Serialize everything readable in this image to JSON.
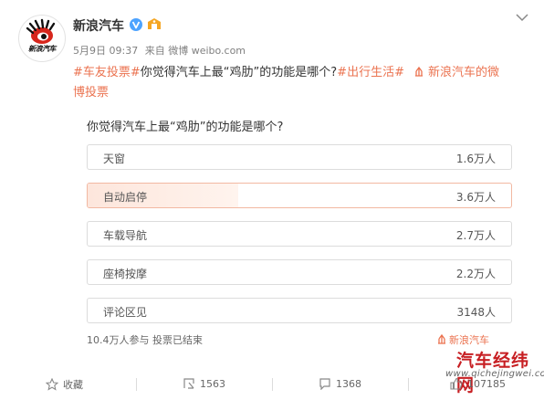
{
  "account": {
    "name": "新浪汽车",
    "avatar_text": "新浪汽车",
    "avatar_icon": "sina-eye-logo",
    "verified_icon": "verified-v-icon",
    "vip_icon": "vip-member-icon",
    "menu_icon": "chevron-down-icon"
  },
  "meta": {
    "date": "5月9日 09:37",
    "from": "来自 微博 weibo.com"
  },
  "post": {
    "tag1": "#车友投票#",
    "text": "你觉得汽车上最“鸡肋”的功能是哪个?",
    "tag2": "#出行生活#",
    "link_icon": "link-icon",
    "link_text_1": "新浪汽车的微",
    "link_text_2": "博投票"
  },
  "poll": {
    "question": "你觉得汽车上最“鸡肋”的功能是哪个?",
    "options": [
      {
        "label": "天窗",
        "count": "1.6万人",
        "votes_wan": 1.6
      },
      {
        "label": "自动启停",
        "count": "3.6万人",
        "votes_wan": 3.6,
        "selected": true
      },
      {
        "label": "车载导航",
        "count": "2.7万人",
        "votes_wan": 2.7
      },
      {
        "label": "座椅按摩",
        "count": "2.2万人",
        "votes_wan": 2.2
      },
      {
        "label": "评论区见",
        "count": "3148人",
        "votes_wan": 0.3148
      }
    ],
    "footer": "10.4万人参与  投票已结束",
    "brand": "新浪汽车"
  },
  "watermark": {
    "title": "汽车经纬网",
    "url": "www.qichejingwei.com"
  },
  "actions": {
    "favorite_label": "收藏",
    "favorite_icon": "star-icon",
    "repost_count": "1563",
    "repost_icon": "repost-icon",
    "comment_count": "1368",
    "comment_icon": "comment-icon",
    "like_count": "107185",
    "like_icon": "thumbs-up-icon"
  },
  "colors": {
    "accent": "#eb7350",
    "watermark": "#c71f23",
    "selected_fill": "#fde6dc"
  }
}
